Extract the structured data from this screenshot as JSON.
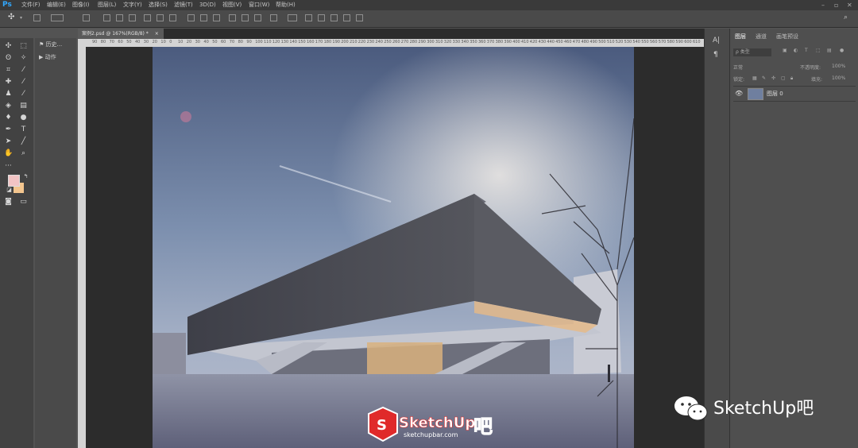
{
  "app": {
    "logo": "Ps"
  },
  "menubar": {
    "items": [
      "文件(F)",
      "编辑(E)",
      "图像(I)",
      "图层(L)",
      "文字(Y)",
      "选择(S)",
      "滤镜(T)",
      "3D(D)",
      "视图(V)",
      "窗口(W)",
      "帮助(H)"
    ]
  },
  "document": {
    "tab_title": "案例2.psd @ 167%(RGB/8) *",
    "close": "×"
  },
  "history_panel": {
    "items": [
      {
        "label": "历史..."
      },
      {
        "label": "动作"
      }
    ]
  },
  "rulers": {
    "top_ticks": [
      "90",
      "80",
      "70",
      "60",
      "50",
      "40",
      "30",
      "20",
      "10",
      "0",
      "10",
      "20",
      "30",
      "40",
      "50",
      "60",
      "70",
      "80",
      "90",
      "100",
      "110",
      "120",
      "130",
      "140",
      "150",
      "160",
      "170",
      "180",
      "190",
      "200",
      "210",
      "220",
      "230",
      "240",
      "250",
      "260",
      "270",
      "280",
      "290",
      "300",
      "310",
      "320",
      "330",
      "340",
      "350",
      "360",
      "370",
      "380",
      "390",
      "400",
      "410",
      "420",
      "430",
      "440",
      "450",
      "460",
      "470",
      "480",
      "490",
      "500",
      "510",
      "520",
      "530",
      "540",
      "550",
      "560",
      "570",
      "580",
      "590",
      "600",
      "610",
      "620",
      "630",
      "640",
      "650",
      "660",
      "670",
      "680",
      "690",
      "700"
    ]
  },
  "layers_panel": {
    "tabs": [
      "图层",
      "通道",
      "画笔预设"
    ],
    "filter_kind": "ρ 类型",
    "blend_mode": "正常",
    "opacity_label": "不透明度:",
    "opacity_value": "100%",
    "lock_label": "锁定:",
    "fill_label": "填充:",
    "fill_value": "100%",
    "layers": [
      {
        "name": "图层 0",
        "visible": true
      }
    ]
  },
  "watermarks": {
    "center": {
      "text": "SketchUp",
      "suffix": "吧",
      "url": "sketchupbar.com"
    },
    "corner": {
      "text": "SketchUp吧"
    }
  },
  "colors": {
    "foreground": "#f2c4c4",
    "background": "#f3c58e",
    "accent": "#31a8ff",
    "brand_red": "#e02a2a"
  }
}
